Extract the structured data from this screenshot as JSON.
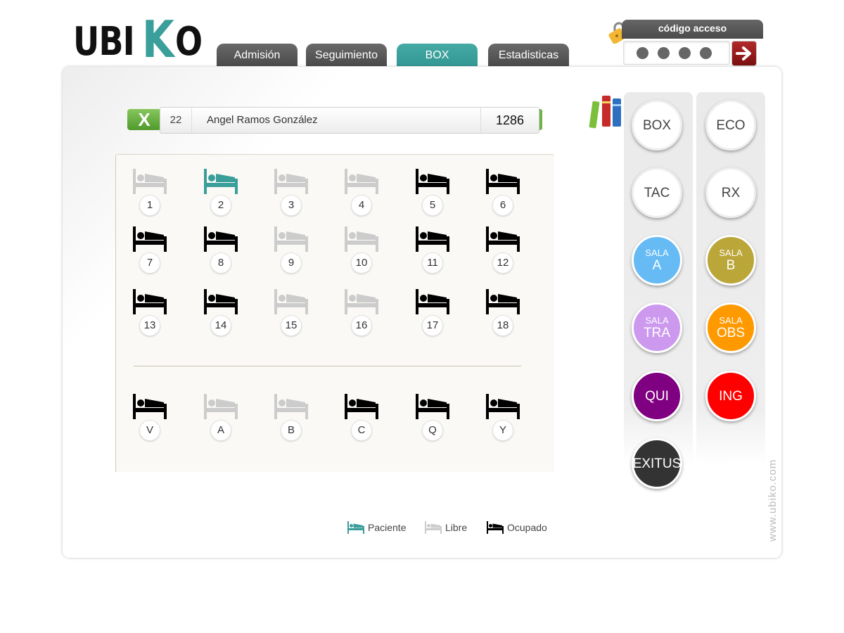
{
  "brand": {
    "logo_part1": "UBI",
    "logo_k": "K",
    "logo_part2": "O"
  },
  "tabs": [
    {
      "label": "Admisión",
      "active": false
    },
    {
      "label": "Seguimiento",
      "active": false
    },
    {
      "label": "BOX",
      "active": true
    },
    {
      "label": "Estadisticas",
      "active": false
    }
  ],
  "access": {
    "title": "código acceso",
    "entered_digits": 4,
    "submit_icon": "arrow-right-icon"
  },
  "patient": {
    "close_label": "X",
    "box_number": "22",
    "name": "Angel Ramos González",
    "code": "1286"
  },
  "colors": {
    "accent": "#3a9e9a",
    "bed_patient": "#3a9e9a",
    "bed_free": "#cccccc",
    "bed_occupied": "#000000"
  },
  "beds_main": [
    {
      "label": "1",
      "status": "free"
    },
    {
      "label": "2",
      "status": "patient"
    },
    {
      "label": "3",
      "status": "free"
    },
    {
      "label": "4",
      "status": "free"
    },
    {
      "label": "5",
      "status": "occupied"
    },
    {
      "label": "6",
      "status": "occupied"
    },
    {
      "label": "7",
      "status": "occupied"
    },
    {
      "label": "8",
      "status": "occupied"
    },
    {
      "label": "9",
      "status": "free"
    },
    {
      "label": "10",
      "status": "free"
    },
    {
      "label": "11",
      "status": "occupied"
    },
    {
      "label": "12",
      "status": "occupied"
    },
    {
      "label": "13",
      "status": "occupied"
    },
    {
      "label": "14",
      "status": "occupied"
    },
    {
      "label": "15",
      "status": "free"
    },
    {
      "label": "16",
      "status": "free"
    },
    {
      "label": "17",
      "status": "occupied"
    },
    {
      "label": "18",
      "status": "occupied"
    }
  ],
  "beds_extra": [
    {
      "label": "V",
      "status": "occupied"
    },
    {
      "label": "A",
      "status": "free"
    },
    {
      "label": "B",
      "status": "free"
    },
    {
      "label": "C",
      "status": "occupied"
    },
    {
      "label": "Q",
      "status": "occupied"
    },
    {
      "label": "Y",
      "status": "occupied"
    }
  ],
  "locations_left": [
    {
      "small": "",
      "big": "BOX",
      "color": "#ffffff"
    },
    {
      "small": "",
      "big": "TAC",
      "color": "#ffffff"
    },
    {
      "small": "SALA",
      "big": "A",
      "color": "#66bbf5"
    },
    {
      "small": "SALA",
      "big": "TRA",
      "color": "#cc99ee"
    },
    {
      "small": "",
      "big": "QUI",
      "color": "#7f0080"
    },
    {
      "small": "",
      "big": "EXITUS",
      "color": "#333333"
    }
  ],
  "locations_right": [
    {
      "small": "",
      "big": "ECO",
      "color": "#ffffff"
    },
    {
      "small": "",
      "big": "RX",
      "color": "#ffffff"
    },
    {
      "small": "SALA",
      "big": "B",
      "color": "#bba63a"
    },
    {
      "small": "SALA",
      "big": "OBS",
      "color": "#ff9900"
    },
    {
      "small": "",
      "big": "ING",
      "color": "#ff0000"
    }
  ],
  "legend": {
    "patient": "Paciente",
    "free": "Libre",
    "occupied": "Ocupado"
  },
  "books_icon": "books-icon",
  "watermark": "www.ubiko.com"
}
